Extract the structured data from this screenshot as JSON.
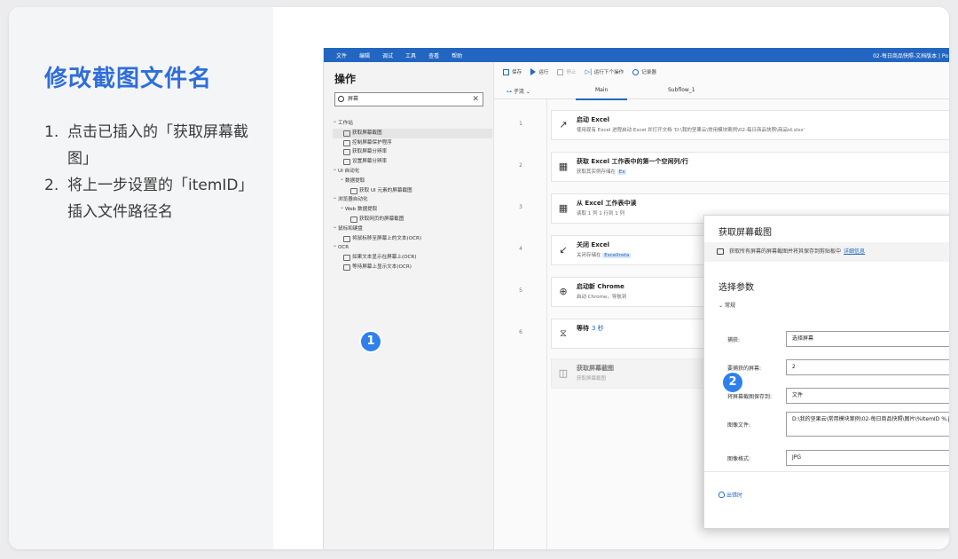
{
  "panel": {
    "title": "修改截图文件名",
    "steps": [
      {
        "num": "1.",
        "text": "点击已插入的「获取屏幕截图」"
      },
      {
        "num": "2.",
        "text": "将上一步设置的「itemID」插入文件路径名"
      }
    ]
  },
  "app": {
    "menu": [
      "文件",
      "编辑",
      "调试",
      "工具",
      "查看",
      "帮助"
    ],
    "window_title": "02-每日商品快照-文档版本 | Po",
    "actions_panel": {
      "title": "操作",
      "search_value": "屏幕",
      "tree": [
        {
          "kind": "cat",
          "label": "工作站"
        },
        {
          "kind": "leaf",
          "label": "获取屏幕截图",
          "selected": true
        },
        {
          "kind": "leaf",
          "label": "控制屏幕保护程序"
        },
        {
          "kind": "leaf",
          "label": "获取屏幕分辨率"
        },
        {
          "kind": "leaf",
          "label": "设置屏幕分辨率"
        },
        {
          "kind": "cat",
          "label": "UI 自动化"
        },
        {
          "kind": "sub",
          "label": "数据提取"
        },
        {
          "kind": "leafdeep",
          "label": "获取 UI 元素的屏幕截图"
        },
        {
          "kind": "cat",
          "label": "浏览器自动化"
        },
        {
          "kind": "sub",
          "label": "Web 数据提取"
        },
        {
          "kind": "leafdeep",
          "label": "获取网页的屏幕截图"
        },
        {
          "kind": "cat",
          "label": "鼠标和键盘"
        },
        {
          "kind": "leaf",
          "label": "将鼠标移至屏幕上的文本(OCR)"
        },
        {
          "kind": "cat",
          "label": "OCR"
        },
        {
          "kind": "leaf",
          "label": "如果文本显示在屏幕上(OCR)"
        },
        {
          "kind": "leaf",
          "label": "等待屏幕上显示文本(OCR)"
        }
      ]
    },
    "toolbar": {
      "save": "保存",
      "run": "运行",
      "stop": "停止",
      "run_next": "运行下个操作",
      "recorder": "记录器"
    },
    "tabs": {
      "subflows": "子流",
      "main": "Main",
      "subflow1": "Subflow_1"
    },
    "steps": [
      {
        "num": "1",
        "icon": "↗",
        "name": "启动 Excel",
        "desc": "使用现有 Excel 进程启动 Excel 并打开文档 'D:\\我的坚果云\\常用模块案例\\02-每日商品快照\\商品id.xlsx'"
      },
      {
        "num": "2",
        "icon": "▦",
        "name": "获取 Excel 工作表中的第一个空闲列/行",
        "desc_pre": "获取其实例存储在 ",
        "desc_hl": "Ex"
      },
      {
        "num": "3",
        "icon": "▦",
        "name": "从 Excel 工作表中读",
        "desc": "读取 1 列 1 行到 1 列"
      },
      {
        "num": "4",
        "icon": "↙",
        "name": "关闭 Excel",
        "desc_pre": "关闭存储在 ",
        "desc_hl": "ExcelInsta"
      },
      {
        "num": "5",
        "icon": "⊕",
        "name": "启动新 Chrome",
        "desc": "启动 Chrome，导航到"
      },
      {
        "num": "6",
        "icon": "⧖",
        "name": "等待",
        "name_suffix": "3 秒"
      },
      {
        "num": "",
        "icon": "◫",
        "name": "获取屏幕截图",
        "desc": "获取屏幕截图"
      }
    ],
    "dialog": {
      "title": "获取屏幕截图",
      "info": "获取所有屏幕的屏幕截图并将其保存到剪贴板中",
      "info_link": "详细信息",
      "section": "选择参数",
      "general": "常规",
      "fields": [
        {
          "label": "捕获:",
          "value": "选择屏幕"
        },
        {
          "label": "要捕获的屏幕:",
          "value": "2"
        },
        {
          "label": "将屏幕截图保存到:",
          "value": "文件"
        },
        {
          "label": "图像文件:",
          "value": "D:\\我的坚果云\\常用模块案例\\02-每日商品快照\\图片\\%ItemID %.jpg"
        },
        {
          "label": "图像格式:",
          "value": "JPG"
        }
      ],
      "timeout": "出错时",
      "save": "保存"
    },
    "badges": [
      "1",
      "2"
    ]
  }
}
